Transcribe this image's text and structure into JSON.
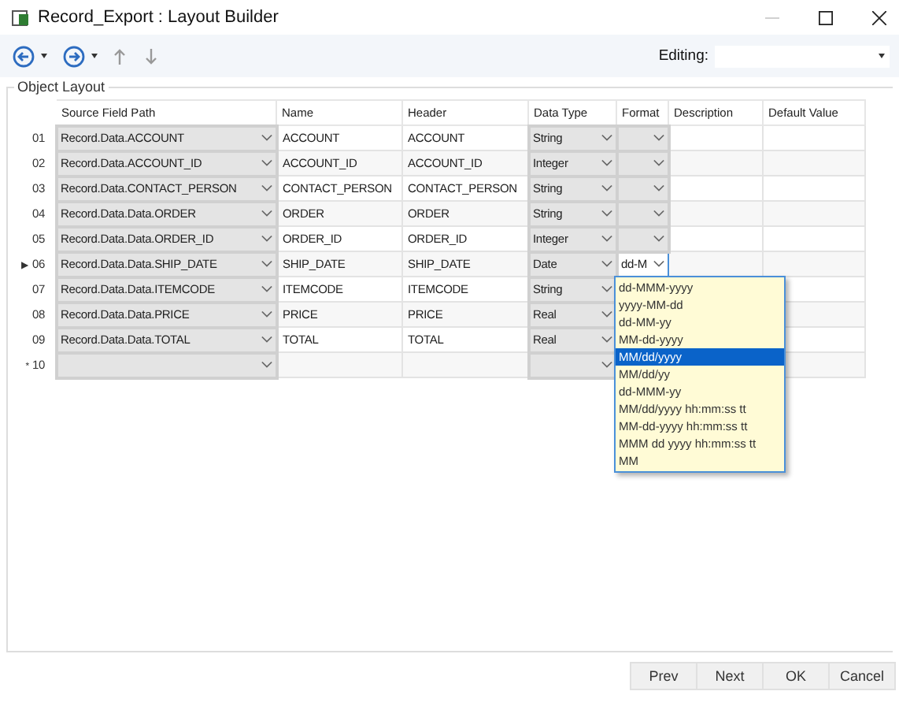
{
  "window": {
    "title": "Record_Export : Layout Builder"
  },
  "toolbar": {
    "editing_label": "Editing:"
  },
  "group": {
    "title": "Object Layout"
  },
  "table": {
    "columns": [
      "Source Field Path",
      "Name",
      "Header",
      "Data Type",
      "Format",
      "Description",
      "Default Value"
    ],
    "rows": [
      {
        "number": "01",
        "marker": "",
        "source": "Record.Data.ACCOUNT",
        "name": "ACCOUNT",
        "header": "ACCOUNT",
        "data_type": "String",
        "format": "",
        "current": false
      },
      {
        "number": "02",
        "marker": "",
        "source": "Record.Data.ACCOUNT_ID",
        "name": "ACCOUNT_ID",
        "header": "ACCOUNT_ID",
        "data_type": "Integer",
        "format": "",
        "current": false
      },
      {
        "number": "03",
        "marker": "",
        "source": "Record.Data.CONTACT_PERSON",
        "name": "CONTACT_PERSON",
        "header": "CONTACT_PERSON",
        "data_type": "String",
        "format": "",
        "current": false
      },
      {
        "number": "04",
        "marker": "",
        "source": "Record.Data.Data.ORDER",
        "name": "ORDER",
        "header": "ORDER",
        "data_type": "String",
        "format": "",
        "current": false
      },
      {
        "number": "05",
        "marker": "",
        "source": "Record.Data.Data.ORDER_ID",
        "name": "ORDER_ID",
        "header": "ORDER_ID",
        "data_type": "Integer",
        "format": "",
        "current": false
      },
      {
        "number": "06",
        "marker": "▶",
        "source": "Record.Data.Data.SHIP_DATE",
        "name": "SHIP_DATE",
        "header": "SHIP_DATE",
        "data_type": "Date",
        "format": "dd-M",
        "current": true
      },
      {
        "number": "07",
        "marker": "",
        "source": "Record.Data.Data.ITEMCODE",
        "name": "ITEMCODE",
        "header": "ITEMCODE",
        "data_type": "String",
        "format": "",
        "current": false
      },
      {
        "number": "08",
        "marker": "",
        "source": "Record.Data.Data.PRICE",
        "name": "PRICE",
        "header": "PRICE",
        "data_type": "Real",
        "format": "",
        "current": false
      },
      {
        "number": "09",
        "marker": "",
        "source": "Record.Data.Data.TOTAL",
        "name": "TOTAL",
        "header": "TOTAL",
        "data_type": "Real",
        "format": "",
        "current": false
      },
      {
        "number": "10",
        "marker": "*",
        "source": "",
        "name": "",
        "header": "",
        "data_type": "",
        "format": "",
        "current": false
      }
    ]
  },
  "format_dropdown": {
    "options": [
      {
        "label": "dd-MMM-yyyy",
        "selected": false
      },
      {
        "label": "yyyy-MM-dd",
        "selected": false
      },
      {
        "label": "dd-MM-yy",
        "selected": false
      },
      {
        "label": "MM-dd-yyyy",
        "selected": false
      },
      {
        "label": "MM/dd/yyyy",
        "selected": true
      },
      {
        "label": "MM/dd/yy",
        "selected": false
      },
      {
        "label": "dd-MMM-yy",
        "selected": false
      },
      {
        "label": "MM/dd/yyyy hh:mm:ss tt",
        "selected": false
      },
      {
        "label": "MM-dd-yyyy hh:mm:ss tt",
        "selected": false
      },
      {
        "label": "MMM dd yyyy hh:mm:ss tt",
        "selected": false
      },
      {
        "label": "MM",
        "selected": false
      }
    ]
  },
  "buttons": [
    "Prev",
    "Next",
    "OK",
    "Cancel"
  ]
}
